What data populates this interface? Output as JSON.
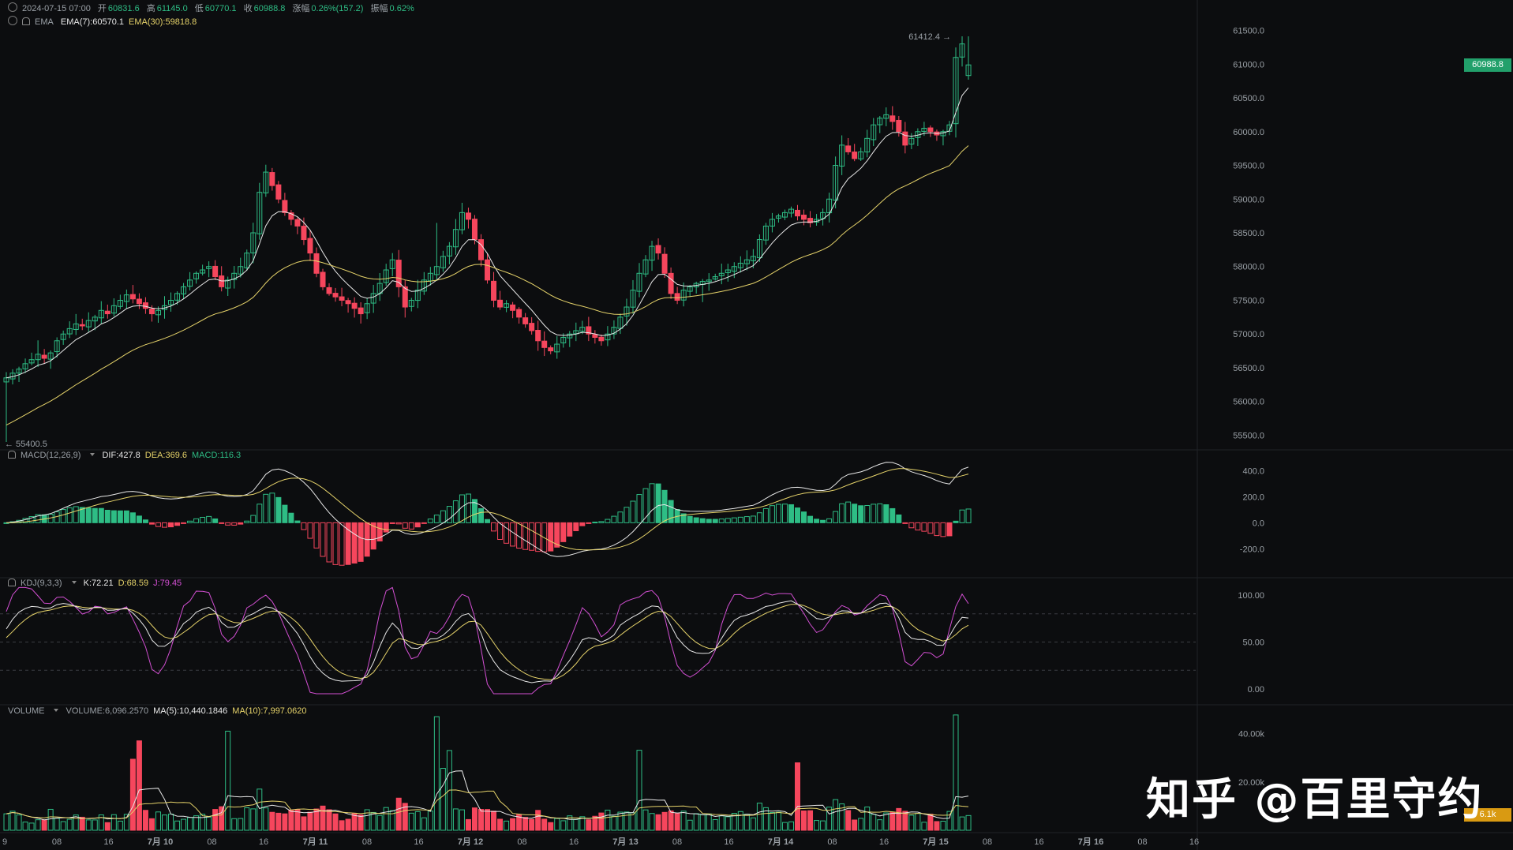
{
  "header": {
    "datetime": "2024-07-15 07:00",
    "open_label": "开",
    "open": "60831.6",
    "high_label": "高",
    "high": "61145.0",
    "low_label": "低",
    "low": "60770.1",
    "close_label": "收",
    "close": "60988.8",
    "change_label": "涨幅",
    "change": "0.26%(157.2)",
    "amp_label": "振幅",
    "amp": "0.62%"
  },
  "ema": {
    "name": "EMA",
    "ema7": "EMA(7):60570.1",
    "ema30": "EMA(30):59818.8"
  },
  "macd": {
    "name": "MACD(12,26,9)",
    "dif": "DIF:427.8",
    "dea": "DEA:369.6",
    "macd": "MACD:116.3"
  },
  "kdj": {
    "name": "KDJ(9,3,3)",
    "k": "K:72.21",
    "d": "D:68.59",
    "j": "J:79.45"
  },
  "volume": {
    "name": "VOLUME",
    "vol": "VOLUME:6,096.2570",
    "ma5": "MA(5):10,440.1846",
    "ma10": "MA(10):7,997.0620"
  },
  "markers": {
    "high": "61412.4",
    "low": "55400.5"
  },
  "price_tag": "60988.8",
  "vol_tag": "6.1k",
  "watermark": "知乎 @百里守约",
  "colors": {
    "up": "#2ebd85",
    "down": "#f6465d",
    "ema7": "#e8e8e8",
    "ema30": "#e6d36a",
    "j": "#d24fd2",
    "dif": "#e8e8e8",
    "dea": "#e6d36a",
    "tag": "#22a06b",
    "vol_tag": "#d99a12"
  },
  "chart_data": [
    {
      "type": "candlestick",
      "interval": "1h",
      "ylim": [
        55400,
        61600
      ],
      "y_ticks": [
        55500,
        56000,
        56500,
        57000,
        57500,
        58000,
        58500,
        59000,
        59500,
        60000,
        60500,
        61000,
        61500
      ],
      "y_tick_labels": [
        "55500.0",
        "56000.0",
        "56500.0",
        "57000.0",
        "57500.0",
        "58000.0",
        "58500.0",
        "59000.0",
        "59500.0",
        "60000.0",
        "60500.0",
        "61000.0",
        "61500.0"
      ],
      "x_tick_labels": [
        "08",
        "16",
        "7月 10",
        "08",
        "16",
        "7月 11",
        "08",
        "16",
        "7月 12",
        "08",
        "16",
        "7月 13",
        "08",
        "16",
        "7月 14",
        "08",
        "16",
        "7月 15",
        "08",
        "16",
        "7月 16",
        "08",
        "16"
      ],
      "path": [
        56350,
        56420,
        56480,
        56560,
        56620,
        56700,
        56640,
        56720,
        56900,
        57000,
        57080,
        57150,
        57120,
        57200,
        57250,
        57350,
        57300,
        57420,
        57500,
        57580,
        57520,
        57450,
        57380,
        57300,
        57350,
        57420,
        57500,
        57600,
        57700,
        57800,
        57900,
        57950,
        58000,
        57850,
        57700,
        57800,
        57900,
        58000,
        58200,
        58500,
        59100,
        59400,
        59200,
        59000,
        58800,
        58700,
        58600,
        58400,
        58200,
        57900,
        57700,
        57600,
        57550,
        57500,
        57450,
        57380,
        57300,
        57450,
        57600,
        57750,
        57950,
        58100,
        57700,
        57400,
        57500,
        57650,
        57800,
        57900,
        58000,
        58150,
        58300,
        58550,
        58800,
        58700,
        58400,
        58100,
        57800,
        57500,
        57400,
        57450,
        57350,
        57250,
        57150,
        57050,
        56900,
        56800,
        56750,
        56850,
        56950,
        57000,
        57050,
        57100,
        57000,
        56950,
        56900,
        57000,
        57100,
        57250,
        57400,
        57650,
        57900,
        58100,
        58300,
        58200,
        57900,
        57600,
        57500,
        57650,
        57700,
        57750,
        57780,
        57800,
        57850,
        57900,
        57950,
        58000,
        58050,
        58100,
        58150,
        58400,
        58600,
        58700,
        58750,
        58800,
        58850,
        58750,
        58700,
        58650,
        58700,
        58800,
        59000,
        59500,
        59800,
        59700,
        59600,
        59700,
        59900,
        60100,
        60200,
        60250,
        60150,
        60000,
        59800,
        59900,
        60000,
        60050,
        60000,
        59950,
        60000,
        60100,
        61100,
        61300,
        60988
      ],
      "low_marker": 55400.5,
      "high_marker": 61412.4,
      "last": 60988.8
    },
    {
      "type": "bar",
      "name": "MACD(12,26,9)",
      "ylim": [
        -350,
        500
      ],
      "y_tick_labels": [
        "400.0",
        "200.0",
        "0.0",
        "-200.0"
      ],
      "dif": 427.8,
      "dea": 369.6,
      "hist": 116.3
    },
    {
      "type": "line",
      "name": "KDJ(9,3,3)",
      "ylim": [
        -10,
        110
      ],
      "y_tick_labels": [
        "100.00",
        "50.00",
        "0.00"
      ],
      "k": 72.21,
      "d": 68.59,
      "j": 79.45
    },
    {
      "type": "bar",
      "name": "VOLUME",
      "ylim": [
        0,
        48000
      ],
      "y_tick_labels": [
        "40.00k",
        "20.00k"
      ],
      "last": 6096.257
    }
  ]
}
